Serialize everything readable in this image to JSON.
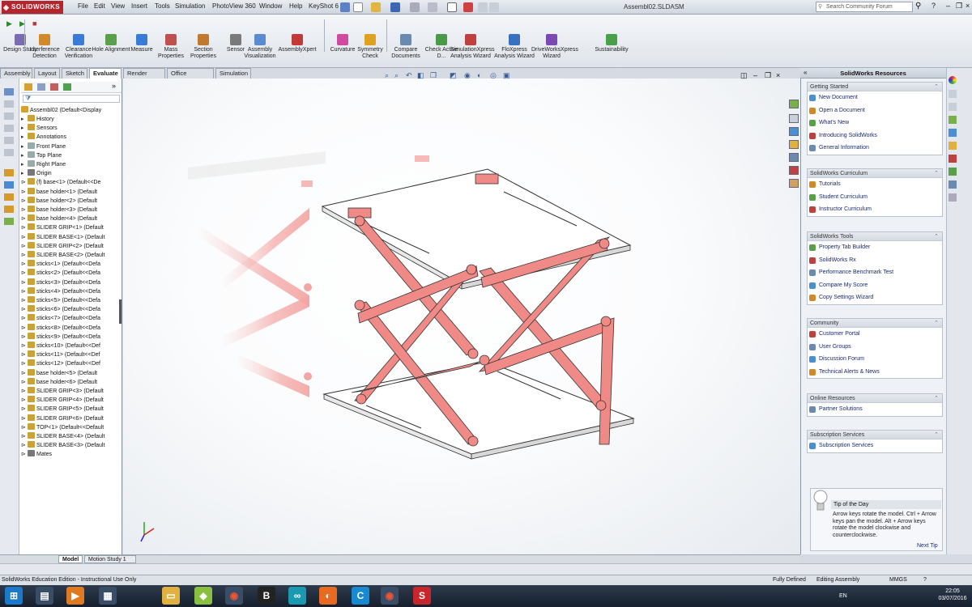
{
  "app": {
    "brand": "SOLIDWORKS",
    "title": "Assembl02.SLDASM",
    "search_placeholder": "Search Community Forum",
    "menu": [
      "File",
      "Edit",
      "View",
      "Insert",
      "Tools",
      "Simulation",
      "PhotoView 360",
      "Window",
      "Help",
      "KeyShot 6"
    ]
  },
  "commands": [
    {
      "label": "Design Study",
      "color": "#7a6bb2"
    },
    {
      "label": "Interference Detection",
      "color": "#d08a2a"
    },
    {
      "label": "Clearance Verification",
      "color": "#3a7bd5"
    },
    {
      "label": "Hole Alignment",
      "color": "#5aa04a"
    },
    {
      "label": "Measure",
      "color": "#3a7bd5"
    },
    {
      "label": "Mass Properties",
      "color": "#c05050"
    },
    {
      "label": "Section Properties",
      "color": "#c07a30"
    },
    {
      "label": "Sensor",
      "color": "#7a7a7a"
    },
    {
      "label": "Assembly Visualization",
      "color": "#5a8ad0"
    },
    {
      "label": "AssemblyXpert",
      "color": "#c03a3a"
    },
    {
      "label": "Curvature",
      "color": "#d04aa0"
    },
    {
      "label": "Symmetry Check",
      "color": "#e0a020"
    },
    {
      "label": "Compare Documents",
      "color": "#6a8ab0"
    },
    {
      "label": "Check Active D...",
      "color": "#4a9a4a"
    },
    {
      "label": "SimulationXpress Analysis Wizard",
      "color": "#c04040"
    },
    {
      "label": "FloXpress Analysis Wizard",
      "color": "#3a70c0"
    },
    {
      "label": "DriveWorksXpress Wizard",
      "color": "#7a4ab0"
    },
    {
      "label": "Sustainability",
      "color": "#4aa04a"
    }
  ],
  "tabs": [
    "Assembly",
    "Layout",
    "Sketch",
    "Evaluate",
    "Render Tools",
    "Office Products",
    "Simulation"
  ],
  "active_tab": "Evaluate",
  "tree": {
    "root": "Assembl02 (Default<Display",
    "items": [
      {
        "name": "History",
        "icon": "history-icon",
        "color": "#c9a33a"
      },
      {
        "name": "Sensors",
        "icon": "sensor-icon",
        "color": "#c9a33a"
      },
      {
        "name": "Annotations",
        "icon": "annotation-icon",
        "color": "#c9a33a"
      },
      {
        "name": "Front Plane",
        "icon": "plane-icon",
        "color": "#9aa"
      },
      {
        "name": "Top Plane",
        "icon": "plane-icon",
        "color": "#9aa"
      },
      {
        "name": "Right Plane",
        "icon": "plane-icon",
        "color": "#9aa"
      },
      {
        "name": "Origin",
        "icon": "origin-icon",
        "color": "#777"
      },
      {
        "name": "(f) base<1> (Default<<De",
        "icon": "part-icon",
        "color": "#c9a33a"
      },
      {
        "name": "base holder<1> (Default",
        "icon": "part-icon",
        "color": "#c9a33a"
      },
      {
        "name": "base holder<2> (Default",
        "icon": "part-icon",
        "color": "#c9a33a"
      },
      {
        "name": "base holder<3> (Default",
        "icon": "part-icon",
        "color": "#c9a33a"
      },
      {
        "name": "base holder<4> (Default",
        "icon": "part-icon",
        "color": "#c9a33a"
      },
      {
        "name": "SLIDER GRIP<1> (Default",
        "icon": "part-icon",
        "color": "#c9a33a"
      },
      {
        "name": "SLIDER BASE<1> (Default",
        "icon": "part-icon",
        "color": "#c9a33a"
      },
      {
        "name": "SLIDER GRIP<2> (Default",
        "icon": "part-icon",
        "color": "#c9a33a"
      },
      {
        "name": "SLIDER BASE<2> (Default",
        "icon": "part-icon",
        "color": "#c9a33a"
      },
      {
        "name": "sticks<1> (Default<<Defa",
        "icon": "part-icon",
        "color": "#c9a33a"
      },
      {
        "name": "sticks<2> (Default<<Defa",
        "icon": "part-icon",
        "color": "#c9a33a"
      },
      {
        "name": "sticks<3> (Default<<Defa",
        "icon": "part-icon",
        "color": "#c9a33a"
      },
      {
        "name": "sticks<4> (Default<<Defa",
        "icon": "part-icon",
        "color": "#c9a33a"
      },
      {
        "name": "sticks<5> (Default<<Defa",
        "icon": "part-icon",
        "color": "#c9a33a"
      },
      {
        "name": "sticks<6> (Default<<Defa",
        "icon": "part-icon",
        "color": "#c9a33a"
      },
      {
        "name": "sticks<7> (Default<<Defa",
        "icon": "part-icon",
        "color": "#c9a33a"
      },
      {
        "name": "sticks<8> (Default<<Defa",
        "icon": "part-icon",
        "color": "#c9a33a"
      },
      {
        "name": "sticks<9> (Default<<Defa",
        "icon": "part-icon",
        "color": "#c9a33a"
      },
      {
        "name": "sticks<10> (Default<<Def",
        "icon": "part-icon",
        "color": "#c9a33a"
      },
      {
        "name": "sticks<11> (Default<<Def",
        "icon": "part-icon",
        "color": "#c9a33a"
      },
      {
        "name": "sticks<12> (Default<<Def",
        "icon": "part-icon",
        "color": "#c9a33a"
      },
      {
        "name": "base holder<5> (Default",
        "icon": "part-icon",
        "color": "#c9a33a"
      },
      {
        "name": "base holder<6> (Default",
        "icon": "part-icon",
        "color": "#c9a33a"
      },
      {
        "name": "SLIDER GRIP<3> (Default",
        "icon": "part-icon",
        "color": "#c9a33a"
      },
      {
        "name": "SLIDER GRIP<4> (Default",
        "icon": "part-icon",
        "color": "#c9a33a"
      },
      {
        "name": "SLIDER GRIP<5> (Default",
        "icon": "part-icon",
        "color": "#c9a33a"
      },
      {
        "name": "SLIDER GRIP<6> (Default",
        "icon": "part-icon",
        "color": "#c9a33a"
      },
      {
        "name": "TOP<1> (Default<<Default",
        "icon": "part-icon",
        "color": "#c9a33a"
      },
      {
        "name": "SLIDER BASE<4> (Default",
        "icon": "part-icon",
        "color": "#c9a33a"
      },
      {
        "name": "SLIDER BASE<3> (Default",
        "icon": "part-icon",
        "color": "#c9a33a"
      },
      {
        "name": "Mates",
        "icon": "mates-icon",
        "color": "#777"
      }
    ]
  },
  "taskpane": {
    "title": "SolidWorks Resources",
    "sections": [
      {
        "title": "Getting Started",
        "items": [
          "New Document",
          "Open a Document",
          "What's New",
          "Introducing SolidWorks",
          "General Information"
        ]
      },
      {
        "title": "SolidWorks Curriculum",
        "items": [
          "Tutorials",
          "Student Curriculum",
          "Instructor Curriculum"
        ]
      },
      {
        "title": "SolidWorks Tools",
        "items": [
          "Property Tab Builder",
          "SolidWorks Rx",
          "Performance Benchmark Test",
          "Compare My Score",
          "Copy Settings Wizard"
        ]
      },
      {
        "title": "Community",
        "items": [
          "Customer Portal",
          "User Groups",
          "Discussion Forum",
          "Technical Alerts & News"
        ]
      },
      {
        "title": "Online Resources",
        "items": [
          "Partner Solutions"
        ]
      },
      {
        "title": "Subscription Services",
        "items": [
          "Subscription Services"
        ]
      }
    ],
    "tip_title": "Tip of the Day",
    "tip_text": "Arrow keys rotate the model. Ctrl + Arrow keys pan the model. Alt + Arrow keys rotate the model clockwise and counterclockwise.",
    "next_tip": "Next Tip"
  },
  "bottom_tabs": [
    "Model",
    "Motion Study 1"
  ],
  "status": {
    "left": "SolidWorks Education Edition - Instructional Use Only",
    "state": "Fully Defined",
    "mode": "Editing Assembly",
    "units": "MMGS"
  },
  "clock": {
    "time": "22:05",
    "date": "03/07/2016"
  },
  "tray_lang": "EN",
  "colors": {
    "accent": "#b3262d",
    "link": "#1a2a6a",
    "part": "#f08a86"
  }
}
